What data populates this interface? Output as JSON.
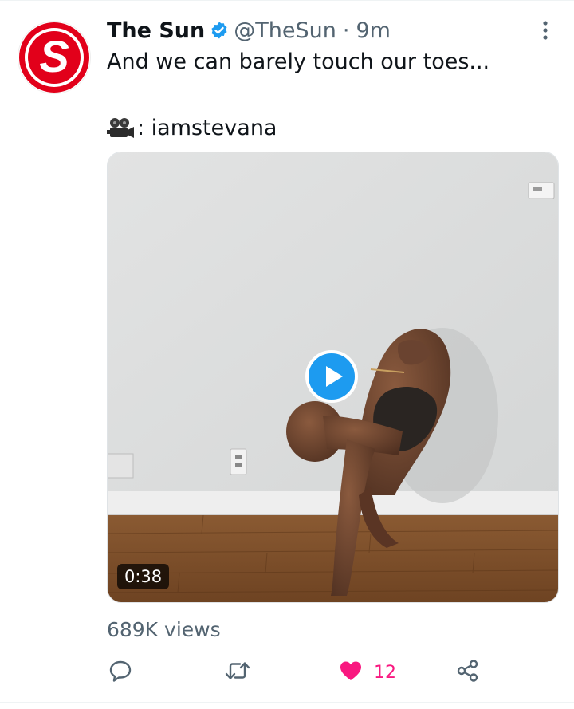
{
  "tweet": {
    "author_name": "The Sun",
    "handle": "@TheSun",
    "separator": "·",
    "time": "9m",
    "text_line1": "And we can barely touch our toes...",
    "credit": ": iamstevana",
    "credit_icon": "movie-camera-icon",
    "verified_icon": "verified-badge-icon",
    "avatar_letter": "S",
    "brand_color": "#e2001a",
    "verified_color": "#1d9bf0",
    "like_color": "#f91880"
  },
  "video": {
    "duration": "0:38",
    "play_icon": "play-icon"
  },
  "stats": {
    "views": "689K views",
    "likes": "12"
  },
  "actions": [
    "reply-icon",
    "retweet-icon",
    "like-icon",
    "share-icon"
  ]
}
